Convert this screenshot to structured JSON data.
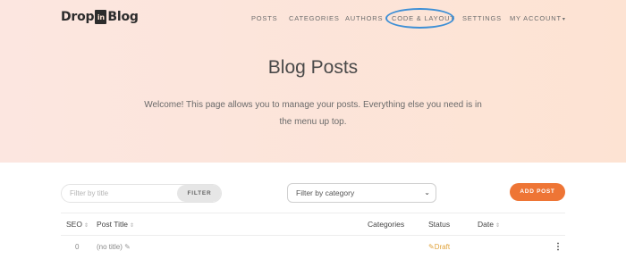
{
  "logo": {
    "left": "Drop",
    "in": "in",
    "right": "Blog"
  },
  "nav": [
    {
      "label": "POSTS"
    },
    {
      "label": "CATEGORIES"
    },
    {
      "label": "AUTHORS"
    },
    {
      "label": "CODE & LAYOUT"
    },
    {
      "label": "SETTINGS"
    },
    {
      "label": "MY ACCOUNT"
    }
  ],
  "highlight_color": "#3d8fd6",
  "page": {
    "title": "Blog Posts",
    "intro": "Welcome! This page allows you to manage your posts. Everything else you need is in the menu up top."
  },
  "toolbar": {
    "filter_placeholder": "Filter by title",
    "filter_button": "FILTER",
    "category_select": "Filter by category",
    "add_post": "ADD POST"
  },
  "table": {
    "headers": {
      "seo": "SEO",
      "post_title": "Post Title",
      "categories": "Categories",
      "status": "Status",
      "date": "Date"
    },
    "rows": [
      {
        "seo": "0",
        "title": "(no title)",
        "status": "Draft"
      }
    ]
  },
  "colors": {
    "accent": "#ee7535",
    "draft": "#e0a23a"
  }
}
